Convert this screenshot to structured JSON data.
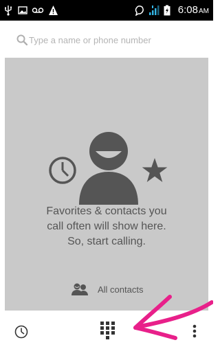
{
  "status_bar": {
    "icons": [
      "usb-icon",
      "image-icon",
      "voicemail-icon",
      "warning-icon",
      "alarm-icon",
      "signal-icon",
      "battery-icon"
    ],
    "time": "6:08",
    "ampm": "AM"
  },
  "search": {
    "placeholder": "Type a name or phone number",
    "value": ""
  },
  "empty_state": {
    "message_lines": [
      "Favorites & contacts you",
      "call often will show here.",
      "So, start calling."
    ],
    "illustration_icons": [
      "clock-icon",
      "person-icon",
      "star-icon"
    ]
  },
  "all_contacts": {
    "label": "All contacts",
    "icon": "contacts-icon"
  },
  "bottom_bar": {
    "icons": [
      "recent-calls-icon",
      "dialpad-icon",
      "overflow-menu-icon"
    ]
  },
  "colors": {
    "status_bar_bg": "#000000",
    "panel_bg": "#c9c9c9",
    "illustration": "#555555",
    "text_secondary": "#555555",
    "placeholder": "#b4b4b4",
    "signal_accent": "#33b5e5",
    "annotation_arrow": "#e8208a"
  }
}
